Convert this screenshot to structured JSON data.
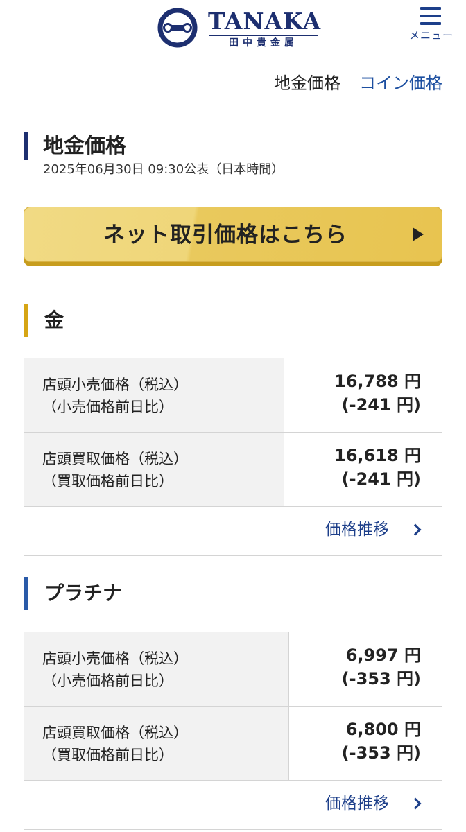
{
  "header": {
    "logo_word": "TANAKA",
    "logo_sub": "田中貴金属",
    "menu_label": "メニュー"
  },
  "tabs": [
    {
      "label": "地金価格"
    },
    {
      "label": "コイン価格"
    }
  ],
  "page": {
    "title": "地金価格",
    "announced": "2025年06月30日 09:30公表（日本時間）"
  },
  "cta": {
    "label": "ネット取引価格はこちら"
  },
  "metals": [
    {
      "name": "金",
      "accent": "#d6a514",
      "rows": [
        {
          "label1": "店頭小売価格（税込）",
          "label2": "（小売価格前日比）",
          "price": "16,788 円",
          "change": "(-241 円)"
        },
        {
          "label1": "店頭買取価格（税込）",
          "label2": "（買取価格前日比）",
          "price": "16,618 円",
          "change": "(-241 円)"
        }
      ],
      "trend_label": "価格推移"
    },
    {
      "name": "プラチナ",
      "accent": "#2a5aa8",
      "rows": [
        {
          "label1": "店頭小売価格（税込）",
          "label2": "（小売価格前日比）",
          "price": "6,997 円",
          "change": "(-353 円)"
        },
        {
          "label1": "店頭買取価格（税込）",
          "label2": "（買取価格前日比）",
          "price": "6,800 円",
          "change": "(-353 円)"
        }
      ],
      "trend_label": "価格推移"
    }
  ],
  "colors": {
    "brand_navy": "#1d2f70",
    "link_blue": "#1d3f8a",
    "cta_gold": "#e8c450"
  }
}
